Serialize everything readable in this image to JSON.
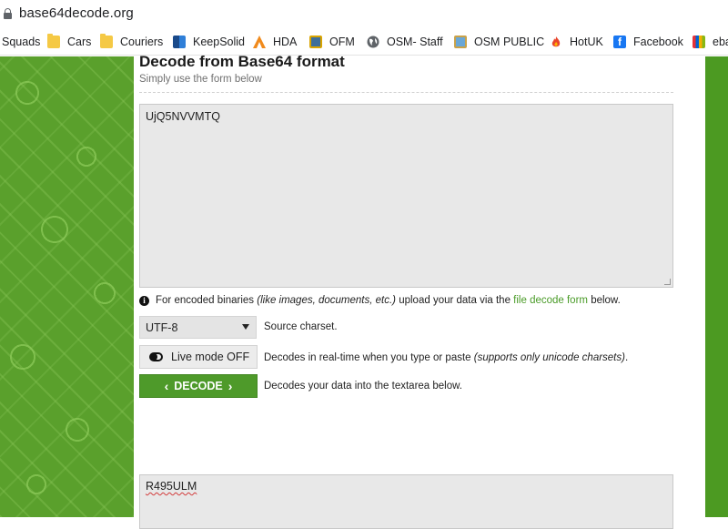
{
  "browser": {
    "url": "base64decode.org",
    "bookmarks": [
      {
        "label": "Squads",
        "icon": "folder-icon"
      },
      {
        "label": "Cars",
        "icon": "folder-icon"
      },
      {
        "label": "Couriers",
        "icon": "folder-icon"
      },
      {
        "label": "KeepSolid",
        "icon": "keepsolid-icon"
      },
      {
        "label": "HDA",
        "icon": "hda-icon"
      },
      {
        "label": "OFM",
        "icon": "ofm-icon"
      },
      {
        "label": "OSM- Staff",
        "icon": "globe-icon"
      },
      {
        "label": "OSM PUBLIC",
        "icon": "osm-public-icon"
      },
      {
        "label": "HotUK",
        "icon": "flame-icon"
      },
      {
        "label": "Facebook",
        "icon": "facebook-icon"
      },
      {
        "label": "eba",
        "icon": "ebay-icon"
      }
    ]
  },
  "page": {
    "title": "Decode from Base64 format",
    "subtitle": "Simply use the form below",
    "input_value": "UjQ5NVVMTQ",
    "info_prefix": "For encoded binaries ",
    "info_italic": "(like images, documents, etc.)",
    "info_middle": " upload your data via the ",
    "info_link": "file decode form",
    "info_suffix": " below.",
    "charset_value": "UTF-8",
    "charset_desc": "Source charset.",
    "live_mode_label": "Live mode OFF",
    "live_mode_desc_prefix": "Decodes in real-time when you type or paste ",
    "live_mode_desc_italic": "(supports only unicode charsets)",
    "live_mode_desc_suffix": ".",
    "decode_label": "DECODE",
    "decode_desc": "Decodes your data into the textarea below.",
    "output_value": "R495ULM"
  },
  "colors": {
    "brand_green": "#4e9a2a",
    "link_green": "#4a9b28",
    "pattern_green": "#5aa02c"
  }
}
